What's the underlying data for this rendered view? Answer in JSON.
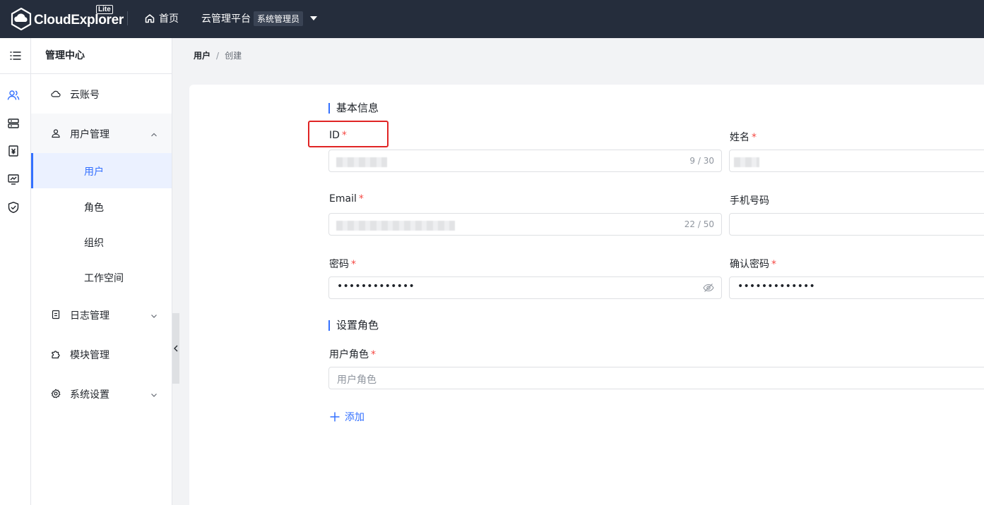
{
  "header": {
    "logo_text": "CloudExplorer",
    "logo_badge": "Lite",
    "home_label": "首页",
    "platform_label": "云管理平台",
    "role_label": "系统管理员"
  },
  "rail": {
    "icons": [
      "menu-list-icon",
      "users-icon",
      "server-icon",
      "bill-icon",
      "monitor-icon",
      "shield-icon"
    ]
  },
  "menu": {
    "title": "管理中心",
    "items": {
      "cloud_account": "云账号",
      "user_mgmt": "用户管理",
      "user": "用户",
      "role": "角色",
      "org": "组织",
      "workspace": "工作空间",
      "log_mgmt": "日志管理",
      "module_mgmt": "模块管理",
      "system_settings": "系统设置"
    }
  },
  "breadcrumb": {
    "level1": "用户",
    "separator": "/",
    "level2": "创建"
  },
  "form": {
    "section_basic": "基本信息",
    "id_label": "ID",
    "id_counter": "9 / 30",
    "name_label": "姓名",
    "email_label": "Email",
    "email_counter": "22 / 50",
    "phone_label": "手机号码",
    "password_label": "密码",
    "password_value": "•••••••••••••",
    "confirm_label": "确认密码",
    "confirm_value": "•••••••••••••",
    "section_role": "设置角色",
    "role_label": "用户角色",
    "role_placeholder": "用户角色",
    "add_label": "添加",
    "required_mark": "*"
  },
  "colors": {
    "topbar": "#252d3c",
    "accent": "#3370ff",
    "required": "#f54a45",
    "highlight_box": "#e02424"
  }
}
